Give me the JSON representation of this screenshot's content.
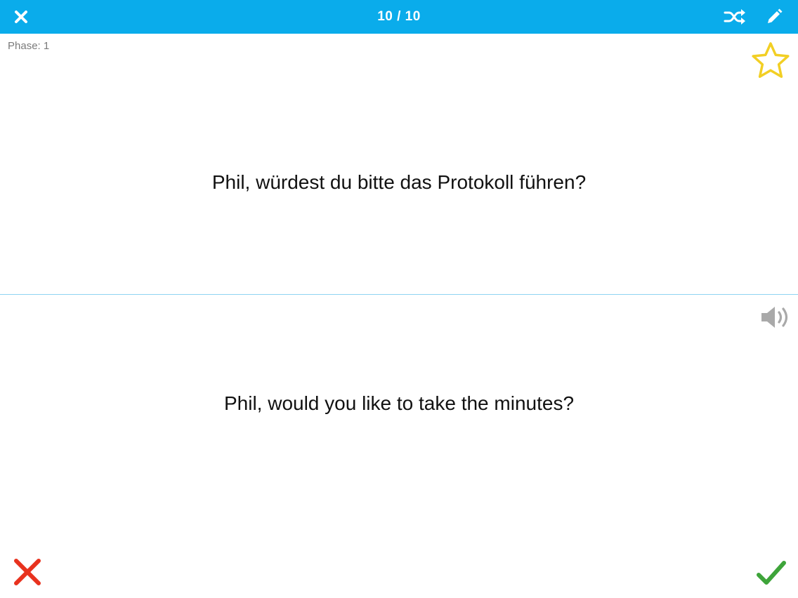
{
  "header": {
    "counter": "10 / 10",
    "close_icon": "close-icon",
    "shuffle_icon": "shuffle-icon",
    "edit_icon": "pencil-icon",
    "bar_color": "#0aaceb"
  },
  "card": {
    "phase_label": "Phase: 1",
    "favorite_icon": "star-outline-icon",
    "favorite_color": "#f2cf24",
    "front_text": "Phil, würdest du bitte das Protokoll führen?",
    "back_text": "Phil, would you like to take the minutes?",
    "audio_icon": "speaker-icon"
  },
  "actions": {
    "wrong_icon": "x-mark-icon",
    "wrong_color": "#e8321e",
    "right_icon": "check-mark-icon",
    "right_color": "#3ea43a"
  }
}
